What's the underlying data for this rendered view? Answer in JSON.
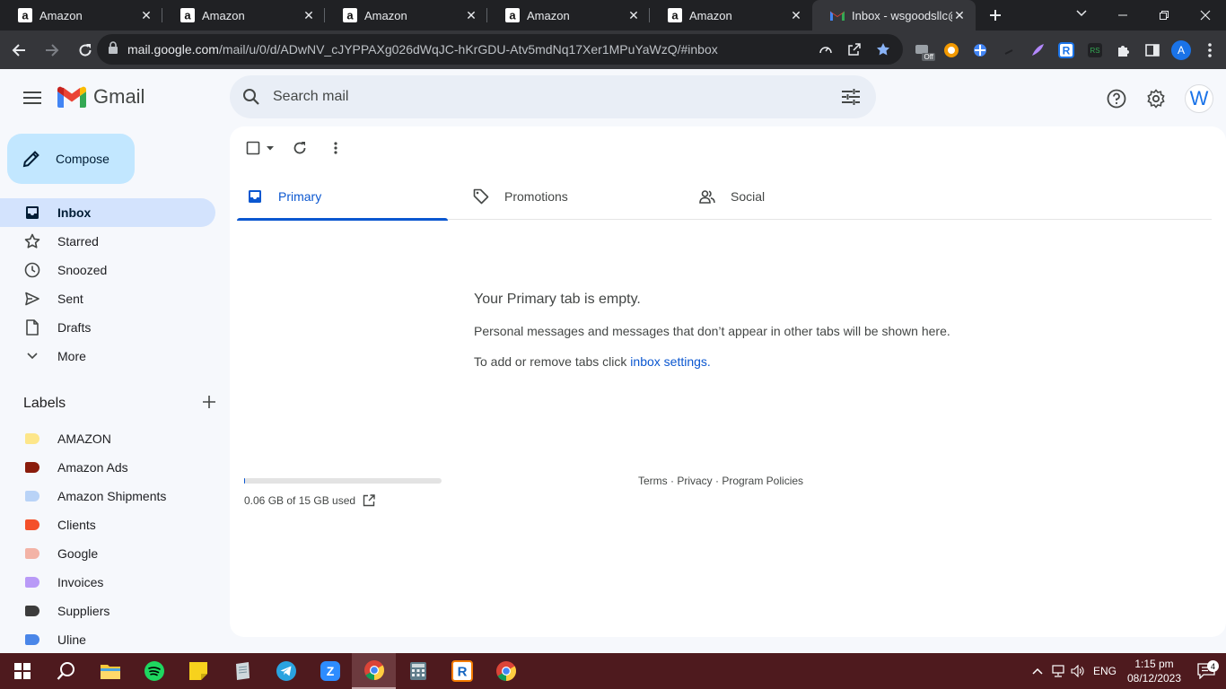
{
  "browser": {
    "tabs": [
      {
        "title": "Amazon",
        "active": false
      },
      {
        "title": "Amazon",
        "active": false
      },
      {
        "title": "Amazon",
        "active": false
      },
      {
        "title": "Amazon",
        "active": false
      },
      {
        "title": "Amazon",
        "active": false
      },
      {
        "title": "Inbox - wsgoodsllc@",
        "active": true
      }
    ],
    "url_host": "mail.google.com",
    "url_path": "/mail/u/0/d/ADwNV_cJYPPAXg026dWqJC-hKrGDU-Atv5mdNq17Xer1MPuYaWzQ/#inbox",
    "profile_initial": "A",
    "ext_badge": "Off"
  },
  "gmail": {
    "app_name": "Gmail",
    "search_placeholder": "Search mail",
    "avatar_initial": "W",
    "compose_label": "Compose",
    "nav": [
      {
        "label": "Inbox",
        "icon": "inbox-icon",
        "active": true
      },
      {
        "label": "Starred",
        "icon": "star-icon",
        "active": false
      },
      {
        "label": "Snoozed",
        "icon": "clock-icon",
        "active": false
      },
      {
        "label": "Sent",
        "icon": "send-icon",
        "active": false
      },
      {
        "label": "Drafts",
        "icon": "draft-icon",
        "active": false
      },
      {
        "label": "More",
        "icon": "chevron-down-icon",
        "active": false
      }
    ],
    "labels_title": "Labels",
    "labels": [
      {
        "name": "AMAZON",
        "color": "#fde68a"
      },
      {
        "name": "Amazon Ads",
        "color": "#8a1c0c"
      },
      {
        "name": "Amazon Shipments",
        "color": "#b9d3f7"
      },
      {
        "name": "Clients",
        "color": "#f4502a"
      },
      {
        "name": "Google",
        "color": "#f3b3a6"
      },
      {
        "name": "Invoices",
        "color": "#b99af7"
      },
      {
        "name": "Suppliers",
        "color": "#3c3c3c"
      },
      {
        "name": "Uline",
        "color": "#4a86e8"
      }
    ],
    "category_tabs": [
      {
        "label": "Primary",
        "icon": "inbox-tray-icon",
        "active": true
      },
      {
        "label": "Promotions",
        "icon": "tag-icon",
        "active": false
      },
      {
        "label": "Social",
        "icon": "people-icon",
        "active": false
      }
    ],
    "empty_title": "Your Primary tab is empty.",
    "empty_desc": "Personal messages and messages that don’t appear in other tabs will be shown here.",
    "empty_hint_prefix": "To add or remove tabs click ",
    "empty_hint_link": "inbox settings",
    "empty_hint_suffix": ".",
    "storage_text": "0.06 GB of 15 GB used",
    "storage_fraction": 0.004,
    "footer": "Terms · Privacy · Program Policies"
  },
  "taskbar": {
    "lang": "ENG",
    "time": "1:15 pm",
    "date": "08/12/2023",
    "notifications": "4"
  },
  "colors": {
    "accent": "#0b57d0",
    "compose_bg": "#c2e7ff",
    "nav_active_bg": "#d3e3fd",
    "taskbar_bg": "#4e1a1e"
  }
}
